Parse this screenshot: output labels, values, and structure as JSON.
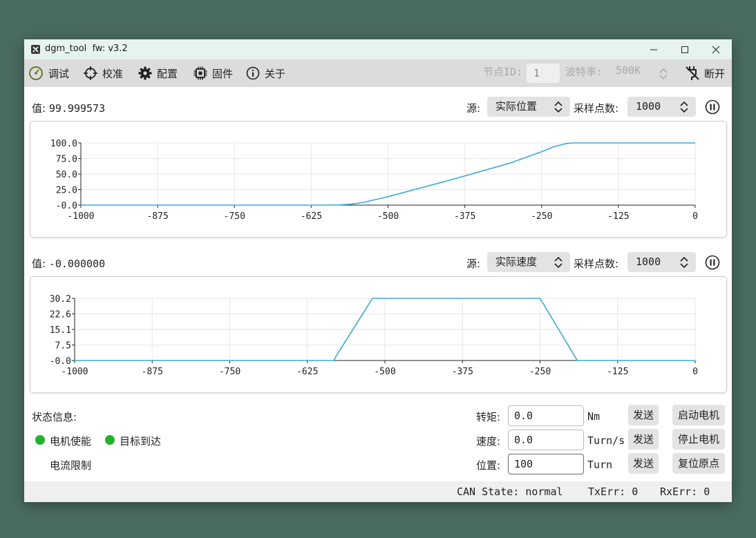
{
  "window": {
    "app_name": "dgm_tool",
    "fw_label": "fw: v3.2"
  },
  "toolbar": {
    "items": [
      {
        "label": "调试",
        "icon": "speedometer-icon"
      },
      {
        "label": "校准",
        "icon": "crosshair-icon"
      },
      {
        "label": "配置",
        "icon": "gear-icon"
      },
      {
        "label": "固件",
        "icon": "chip-icon"
      },
      {
        "label": "关于",
        "icon": "info-icon"
      }
    ],
    "node_id_label": "节点ID:",
    "node_id_value": "1",
    "baud_label": "波特率:",
    "baud_value": "500K",
    "disconnect_label": "断开"
  },
  "panel1": {
    "value_label": "值:",
    "value": "99.999573",
    "source_label": "源:",
    "source_value": "实际位置",
    "samples_label": "采样点数:",
    "samples_value": "1000"
  },
  "panel2": {
    "value_label": "值:",
    "value": "-0.000000",
    "source_label": "源:",
    "source_value": "实际速度",
    "samples_label": "采样点数:",
    "samples_value": "1000"
  },
  "chart_data": [
    {
      "type": "line",
      "title": "",
      "xlim": [
        -1000,
        0
      ],
      "ylim": [
        -0.0,
        100.0
      ],
      "x_ticks": [
        "-1000",
        "-875",
        "-750",
        "-625",
        "-500",
        "-375",
        "-250",
        "-125",
        "0"
      ],
      "y_ticks": [
        "100.0",
        "75.0",
        "50.0",
        "25.0",
        "-0.0"
      ],
      "grid": true,
      "color": "#3aa8d8",
      "x": [
        -1000,
        -600,
        -580,
        -560,
        -540,
        -520,
        -500,
        -400,
        -300,
        -250,
        -230,
        -210,
        -200,
        0
      ],
      "y": [
        0,
        0,
        0.3,
        1.5,
        4.5,
        9,
        13.5,
        40,
        68,
        86,
        94,
        99,
        100,
        100
      ]
    },
    {
      "type": "line",
      "title": "",
      "xlim": [
        -1000,
        0
      ],
      "ylim": [
        -0.0,
        30.2
      ],
      "x_ticks": [
        "-1000",
        "-875",
        "-750",
        "-625",
        "-500",
        "-375",
        "-250",
        "-125",
        "0"
      ],
      "y_ticks": [
        "30.2",
        "22.6",
        "15.1",
        "7.5",
        "-0.0"
      ],
      "grid": true,
      "color": "#3aa8d8",
      "x": [
        -1000,
        -582,
        -580,
        -520,
        -250,
        -190,
        0
      ],
      "y": [
        0,
        0,
        1.5,
        30.2,
        30.2,
        0,
        0
      ]
    }
  ],
  "status": {
    "title": "状态信息:",
    "motor_enable": "电机使能",
    "target_reached": "目标到达",
    "current_limit": "电流限制",
    "led_on_color": "#22b22a"
  },
  "controls": {
    "torque_label": "转矩:",
    "torque_value": "0.0",
    "torque_unit": "Nm",
    "speed_label": "速度:",
    "speed_value": "0.0",
    "speed_unit": "Turn/s",
    "position_label": "位置:",
    "position_value": "100",
    "position_unit": "Turn",
    "send_label": "发送",
    "start_motor": "启动电机",
    "stop_motor": "停止电机",
    "reset_origin": "复位原点"
  },
  "statusbar": {
    "can_state": "CAN State: normal",
    "tx_err": "TxErr: 0",
    "rx_err": "RxErr: 0"
  }
}
